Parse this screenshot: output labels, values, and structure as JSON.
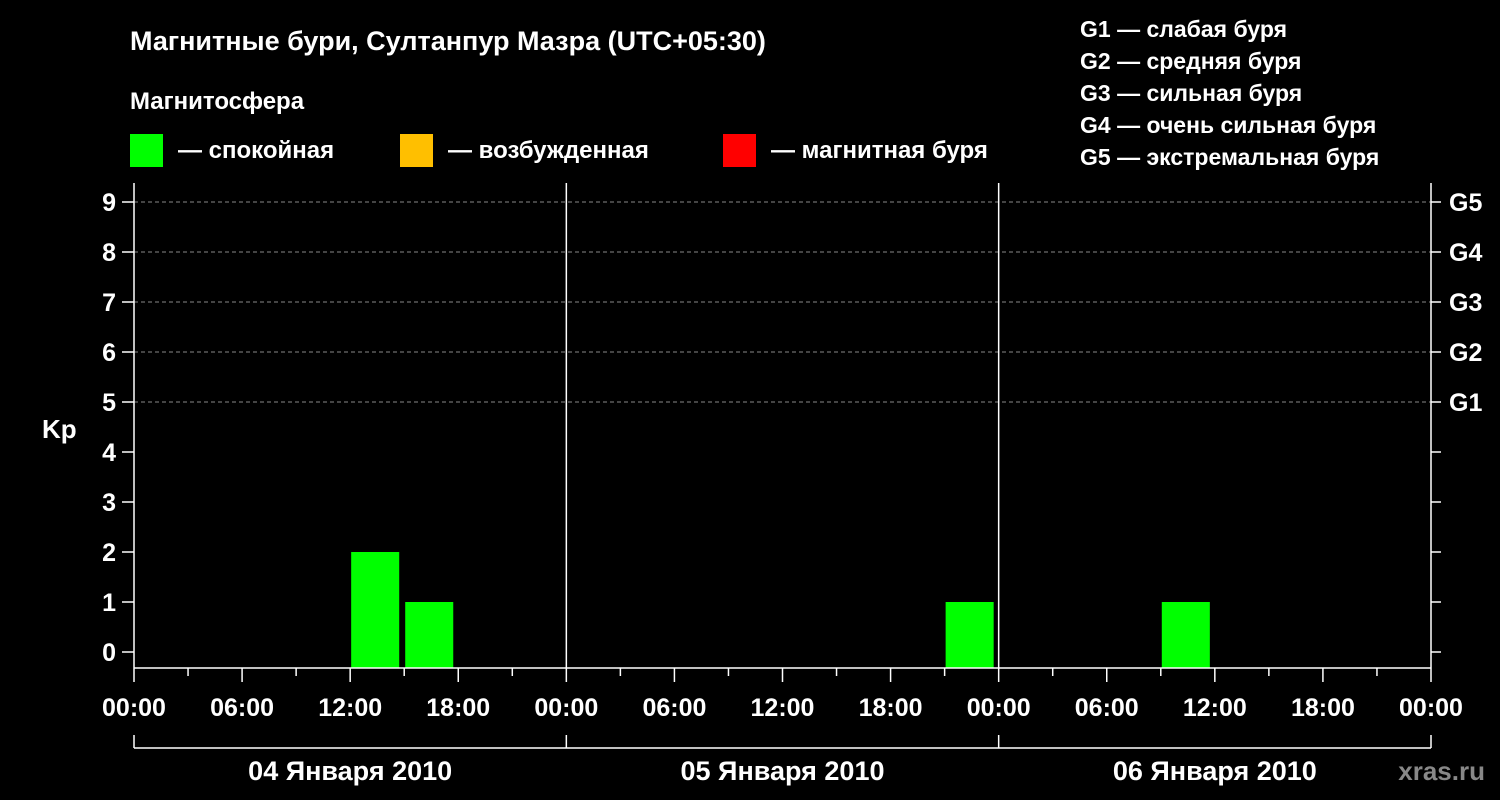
{
  "chart_data": {
    "type": "bar",
    "title": "Магнитные бури, Султанпур Мазра (UTC+05:30)",
    "legend": {
      "title": "Магнитосфера",
      "placement": "top-left",
      "items": [
        {
          "label": "— спокойная",
          "color": "#00ff00"
        },
        {
          "label": "— возбужденная",
          "color": "#ffbf00"
        },
        {
          "label": "— магнитная буря",
          "color": "#ff0000"
        }
      ]
    },
    "g_scale_legend": [
      "G1 — слабая буря",
      "G2 — средняя буря",
      "G3 — сильная буря",
      "G4 — очень сильная буря",
      "G5 — экстремальная буря"
    ],
    "ylabel": "Kp",
    "ylim": [
      0,
      9
    ],
    "yticks": [
      "0",
      "1",
      "2",
      "3",
      "4",
      "5",
      "6",
      "7",
      "8",
      "9"
    ],
    "right_ticks": [
      {
        "kp": 5,
        "label": "G1"
      },
      {
        "kp": 6,
        "label": "G2"
      },
      {
        "kp": 7,
        "label": "G3"
      },
      {
        "kp": 8,
        "label": "G4"
      },
      {
        "kp": 9,
        "label": "G5"
      }
    ],
    "gridlines": [
      5,
      6,
      7,
      8,
      9
    ],
    "xticks": [
      "00:00",
      "06:00",
      "12:00",
      "18:00",
      "00:00",
      "06:00",
      "12:00",
      "18:00",
      "00:00",
      "06:00",
      "12:00",
      "18:00",
      "00:00"
    ],
    "days": [
      "04 Января 2010",
      "05 Января 2010",
      "06 Января 2010"
    ],
    "bars": [
      {
        "day": 0,
        "start_hour": 12,
        "kp": 2,
        "color": "#00ff00"
      },
      {
        "day": 0,
        "start_hour": 15,
        "kp": 1,
        "color": "#00ff00"
      },
      {
        "day": 1,
        "start_hour": 21,
        "kp": 1,
        "color": "#00ff00"
      },
      {
        "day": 2,
        "start_hour": 9,
        "kp": 1,
        "color": "#00ff00"
      }
    ]
  },
  "watermark": "xras.ru"
}
